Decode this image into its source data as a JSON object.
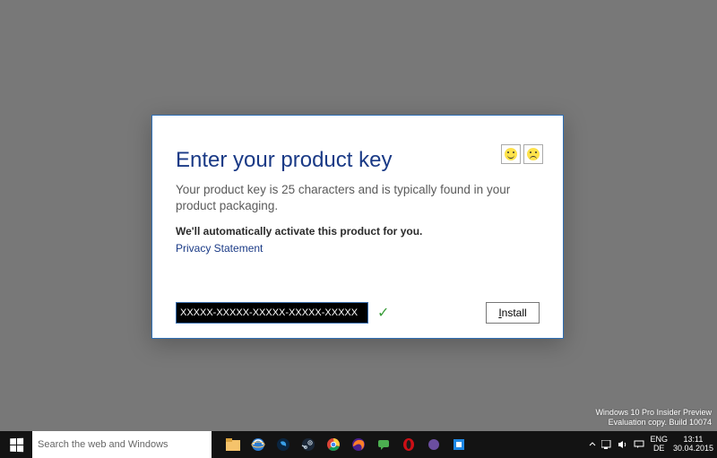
{
  "dialog": {
    "title": "Enter your product key",
    "description": "Your product key is 25 characters and is typically found in your product packaging.",
    "subdescription": "We'll automatically activate this product for you.",
    "privacy_link": "Privacy Statement",
    "input_value": "XXXXX-XXXXX-XXXXX-XXXXX-XXXXX",
    "install_label_prefix": "I",
    "install_label_rest": "nstall",
    "feedback": {
      "happy": "happy-face-icon",
      "sad": "sad-face-icon"
    }
  },
  "watermark": {
    "line1": "Windows 10 Pro Insider Preview",
    "line2": "Evaluation copy. Build 10074"
  },
  "taskbar": {
    "search_placeholder": "Search the web and Windows",
    "lang": {
      "primary": "ENG",
      "secondary": "DE"
    },
    "clock": {
      "time": "13:11",
      "date": "30.04.2015"
    }
  },
  "colors": {
    "accent": "#1a3a86",
    "dialog_border": "#2f6fb5",
    "desktop": "#787878",
    "taskbar": "#131313"
  }
}
